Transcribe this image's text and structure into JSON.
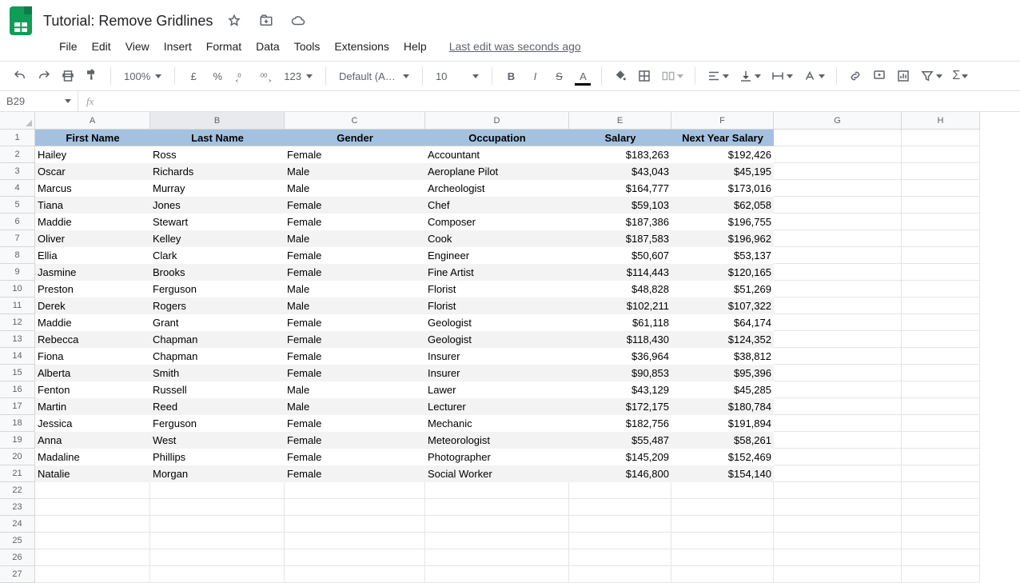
{
  "doc": {
    "title": "Tutorial: Remove Gridlines"
  },
  "menu": {
    "file": "File",
    "edit": "Edit",
    "view": "View",
    "insert": "Insert",
    "format": "Format",
    "data": "Data",
    "tools": "Tools",
    "extensions": "Extensions",
    "help": "Help",
    "last_edit": "Last edit was seconds ago"
  },
  "toolbar": {
    "zoom": "100%",
    "currency": "£",
    "percent": "%",
    "more_formats": "123",
    "font": "Default (Arial)",
    "font_size": "10"
  },
  "name_box": "B29",
  "fx_label": "fx",
  "columns": [
    "A",
    "B",
    "C",
    "D",
    "E",
    "F",
    "G",
    "H"
  ],
  "headers": [
    "First Name",
    "Last Name",
    "Gender",
    "Occupation",
    "Salary",
    "Next Year Salary"
  ],
  "rows": [
    {
      "first": "Hailey",
      "last": "Ross",
      "gender": "Female",
      "occ": "Accountant",
      "salary": "$183,263",
      "next": "$192,426"
    },
    {
      "first": "Oscar",
      "last": "Richards",
      "gender": "Male",
      "occ": "Aeroplane Pilot",
      "salary": "$43,043",
      "next": "$45,195"
    },
    {
      "first": "Marcus",
      "last": "Murray",
      "gender": "Male",
      "occ": "Archeologist",
      "salary": "$164,777",
      "next": "$173,016"
    },
    {
      "first": "Tiana",
      "last": "Jones",
      "gender": "Female",
      "occ": "Chef",
      "salary": "$59,103",
      "next": "$62,058"
    },
    {
      "first": "Maddie",
      "last": "Stewart",
      "gender": "Female",
      "occ": "Composer",
      "salary": "$187,386",
      "next": "$196,755"
    },
    {
      "first": "Oliver",
      "last": "Kelley",
      "gender": "Male",
      "occ": "Cook",
      "salary": "$187,583",
      "next": "$196,962"
    },
    {
      "first": "Ellia",
      "last": "Clark",
      "gender": "Female",
      "occ": "Engineer",
      "salary": "$50,607",
      "next": "$53,137"
    },
    {
      "first": "Jasmine",
      "last": "Brooks",
      "gender": "Female",
      "occ": "Fine Artist",
      "salary": "$114,443",
      "next": "$120,165"
    },
    {
      "first": "Preston",
      "last": "Ferguson",
      "gender": "Male",
      "occ": "Florist",
      "salary": "$48,828",
      "next": "$51,269"
    },
    {
      "first": "Derek",
      "last": "Rogers",
      "gender": "Male",
      "occ": "Florist",
      "salary": "$102,211",
      "next": "$107,322"
    },
    {
      "first": "Maddie",
      "last": "Grant",
      "gender": "Female",
      "occ": "Geologist",
      "salary": "$61,118",
      "next": "$64,174"
    },
    {
      "first": "Rebecca",
      "last": "Chapman",
      "gender": "Female",
      "occ": "Geologist",
      "salary": "$118,430",
      "next": "$124,352"
    },
    {
      "first": "Fiona",
      "last": "Chapman",
      "gender": "Female",
      "occ": "Insurer",
      "salary": "$36,964",
      "next": "$38,812"
    },
    {
      "first": "Alberta",
      "last": "Smith",
      "gender": "Female",
      "occ": "Insurer",
      "salary": "$90,853",
      "next": "$95,396"
    },
    {
      "first": "Fenton",
      "last": "Russell",
      "gender": "Male",
      "occ": "Lawer",
      "salary": "$43,129",
      "next": "$45,285"
    },
    {
      "first": "Martin",
      "last": "Reed",
      "gender": "Male",
      "occ": "Lecturer",
      "salary": "$172,175",
      "next": "$180,784"
    },
    {
      "first": "Jessica",
      "last": "Ferguson",
      "gender": "Female",
      "occ": "Mechanic",
      "salary": "$182,756",
      "next": "$191,894"
    },
    {
      "first": "Anna",
      "last": "West",
      "gender": "Female",
      "occ": "Meteorologist",
      "salary": "$55,487",
      "next": "$58,261"
    },
    {
      "first": "Madaline",
      "last": "Phillips",
      "gender": "Female",
      "occ": "Photographer",
      "salary": "$145,209",
      "next": "$152,469"
    },
    {
      "first": "Natalie",
      "last": "Morgan",
      "gender": "Female",
      "occ": "Social Worker",
      "salary": "$146,800",
      "next": "$154,140"
    }
  ],
  "empty_rows": [
    22,
    23,
    24,
    25,
    26,
    27
  ]
}
